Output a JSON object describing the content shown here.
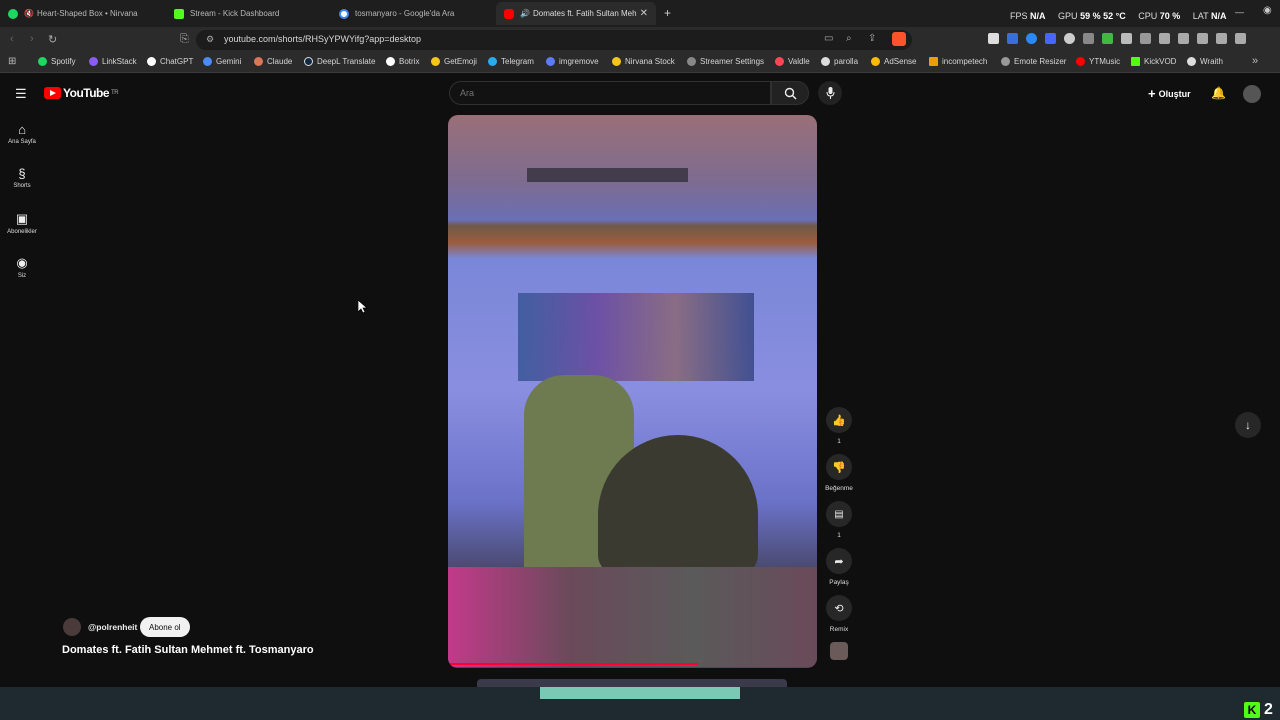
{
  "tabs": [
    {
      "title": "Heart-Shaped Box • Nirvana",
      "color": "#1ed760"
    },
    {
      "title": "Stream - Kick Dashboard",
      "color": "#53fc18"
    },
    {
      "title": "tosmanyaro - Google'da Ara",
      "color": "#4285f4"
    },
    {
      "title": "Domates ft. Fatih Sultan Meh",
      "color": "#ff0000"
    }
  ],
  "stats": {
    "fps_label": "FPS",
    "fps": "N/A",
    "gpu_label": "GPU",
    "gpu": "59 % 52 °C",
    "cpu_label": "CPU",
    "cpu": "70 %",
    "lat_label": "LAT",
    "lat": "N/A"
  },
  "url": "youtube.com/shorts/RHSyYPWYifg?app=desktop",
  "bookmarks": [
    {
      "label": "Spotify",
      "color": "#1ed760"
    },
    {
      "label": "LinkStack",
      "color": "#8a5cf6"
    },
    {
      "label": "ChatGPT",
      "color": "#ffffff"
    },
    {
      "label": "Gemini",
      "color": "#4c8bf5"
    },
    {
      "label": "Claude",
      "color": "#d97757"
    },
    {
      "label": "DeepL Translate",
      "color": "#0f2b46"
    },
    {
      "label": "Botrix",
      "color": "#ffffff"
    },
    {
      "label": "GetEmoji",
      "color": "#f5c518"
    },
    {
      "label": "Telegram",
      "color": "#2aabee"
    },
    {
      "label": "imgremove",
      "color": "#5b7cfa"
    },
    {
      "label": "Nirvana Stock",
      "color": "#f5c518"
    },
    {
      "label": "Streamer Settings",
      "color": "#888888"
    },
    {
      "label": "Valdle",
      "color": "#ff4655"
    },
    {
      "label": "parolla",
      "color": "#dddddd"
    },
    {
      "label": "AdSense",
      "color": "#fbbc04"
    },
    {
      "label": "incompetech",
      "color": "#e6a100"
    },
    {
      "label": "Emote Resizer",
      "color": "#999999"
    },
    {
      "label": "YTMusic",
      "color": "#ff0000"
    },
    {
      "label": "KickVOD",
      "color": "#53fc18"
    },
    {
      "label": "Wraith",
      "color": "#dddddd"
    }
  ],
  "yt": {
    "logo": "YouTube",
    "region": "TR",
    "search_placeholder": "Ara",
    "create": "Oluştur",
    "sidebar": [
      "Ana Sayfa",
      "Shorts",
      "Abonelikler",
      "Siz"
    ],
    "channel": "@polrenheit",
    "subscribe": "Abone ol",
    "video_title": "Domates ft. Fatih Sultan Mehmet ft. Tosmanyaro",
    "likes": "1",
    "dislike_label": "Beğenme",
    "comments": "1",
    "share_label": "Paylaş",
    "remix_label": "Remix"
  },
  "overlay": {
    "kick_count": "2"
  }
}
